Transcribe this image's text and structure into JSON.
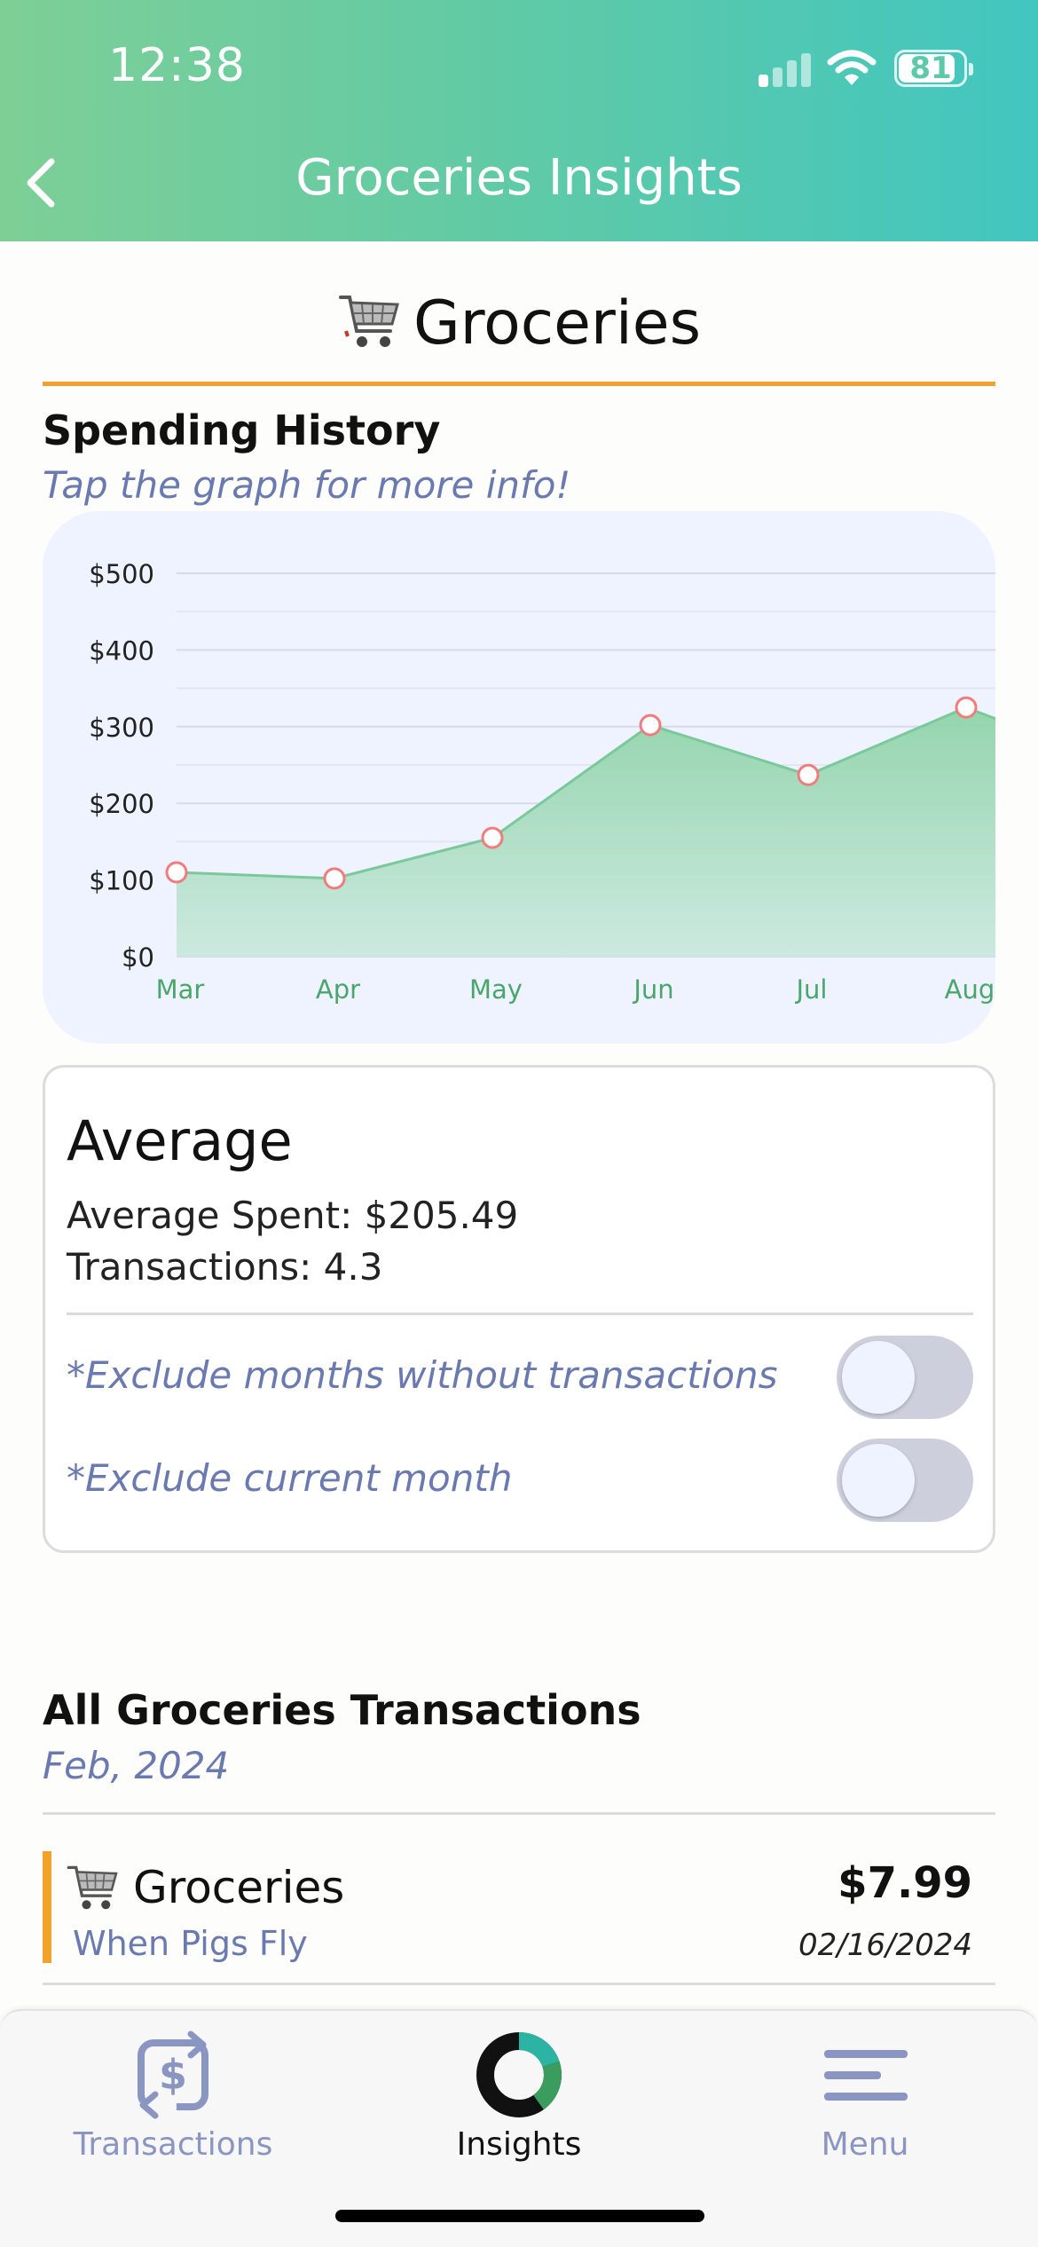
{
  "status_bar": {
    "time": "12:38",
    "battery": "81"
  },
  "header": {
    "title": "Groceries Insights"
  },
  "category": {
    "name": "Groceries",
    "icon": "shopping-cart-icon"
  },
  "spending_history": {
    "title": "Spending History",
    "subtitle": "Tap the graph for more info!"
  },
  "chart_data": {
    "type": "area",
    "categories": [
      "Mar",
      "Apr",
      "May",
      "Jun",
      "Jul",
      "Aug"
    ],
    "values": [
      110,
      102,
      155,
      302,
      237,
      325
    ],
    "yticks": [
      "$500",
      "$400",
      "$300",
      "$200",
      "$100",
      "$0"
    ],
    "ylim": [
      0,
      500
    ],
    "grid": true,
    "colors": {
      "fill": "#8fd3a8",
      "line": "#7ac99a",
      "point": "#f07c7c",
      "axis_text": "#4aa66a"
    }
  },
  "average": {
    "title": "Average",
    "spent": "Average Spent: $205.49",
    "transactions": "Transactions: 4.3",
    "toggle1_label": "*Exclude months without transactions",
    "toggle2_label": "*Exclude current month"
  },
  "transactions_list": {
    "title": "All Groceries Transactions",
    "month": "Feb, 2024",
    "items": [
      {
        "category": "Groceries",
        "merchant": "When Pigs Fly",
        "amount": "$7.99",
        "date": "02/16/2024"
      }
    ]
  },
  "tabbar": {
    "tabs": [
      {
        "label": "Transactions",
        "icon": "transactions-icon"
      },
      {
        "label": "Insights",
        "icon": "insights-donut-icon"
      },
      {
        "label": "Menu",
        "icon": "menu-icon"
      }
    ]
  }
}
